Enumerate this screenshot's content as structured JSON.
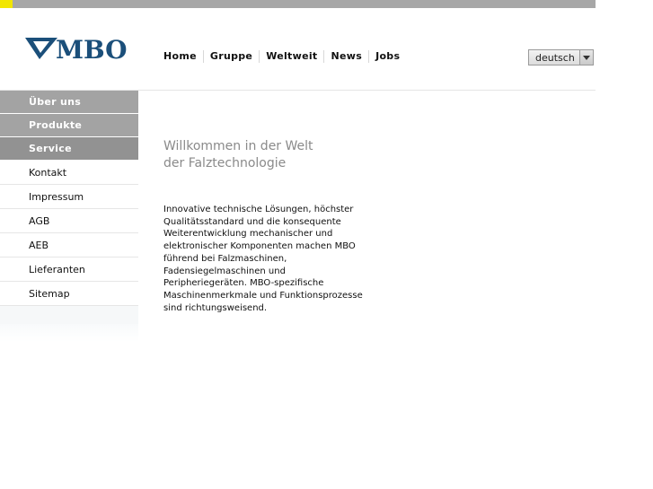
{
  "brand": {
    "name": "MBO"
  },
  "colors": {
    "brand_blue": "#1b4f7a",
    "accent_yellow": "#f2e600",
    "sidebar_gray": "#a3a3a3"
  },
  "nav": {
    "items": [
      "Home",
      "Gruppe",
      "Weltweit",
      "News",
      "Jobs"
    ]
  },
  "language": {
    "selected": "deutsch"
  },
  "sidebar": {
    "sections": [
      "Über uns",
      "Produkte",
      "Service"
    ],
    "items": [
      "Kontakt",
      "Impressum",
      "AGB",
      "AEB",
      "Lieferanten",
      "Sitemap"
    ]
  },
  "main": {
    "heading_line1": "Willkommen in der Welt",
    "heading_line2": "der Falztechnologie",
    "intro": "Innovative technische Lösungen, höchster Qualitätsstandard und die konsequente Weiterentwicklung mechanischer und elektronischer Komponenten machen MBO führend bei Falzmaschinen, Fadensiegelmaschinen und Peripheriegeräten. MBO-spezifische Maschinenmerkmale und Funktionsprozesse sind richtungsweisend."
  }
}
